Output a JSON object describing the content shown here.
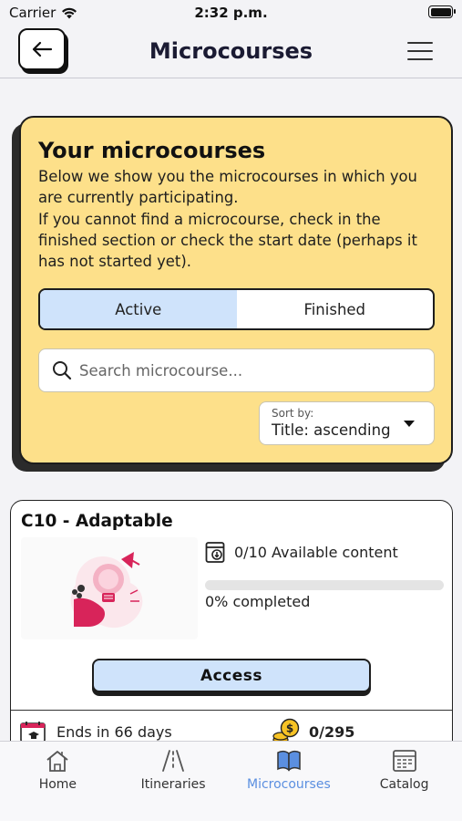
{
  "status_bar": {
    "carrier": "Carrier",
    "time": "2:32 p.m."
  },
  "header": {
    "title": "Microcourses"
  },
  "info": {
    "title": "Your microcourses",
    "lines": [
      "Below we show you the microcourses in which you",
      "are currently participating.",
      "If you cannot find a microcourse, check in the",
      "finished section or check the start date (perhaps it",
      "has not started yet)."
    ],
    "tabs": [
      {
        "label": "Active",
        "selected": true
      },
      {
        "label": "Finished",
        "selected": false
      }
    ],
    "search": {
      "placeholder": "Search microcourse..."
    },
    "sort": {
      "label": "Sort by:",
      "value": "Title: ascending"
    }
  },
  "course": {
    "title": "C10 - Adaptable",
    "available": "0/10 Available content",
    "progress_fraction": 0,
    "completed": "0% completed",
    "access_label": "Access",
    "ends": "Ends in 66 days",
    "coins": "0/295"
  },
  "tabbar": {
    "items": [
      {
        "label": "Home",
        "icon": "home-icon",
        "active": false
      },
      {
        "label": "Itineraries",
        "icon": "road-icon",
        "active": false
      },
      {
        "label": "Microcourses",
        "icon": "book-icon",
        "active": true
      },
      {
        "label": "Catalog",
        "icon": "catalog-icon",
        "active": false
      }
    ]
  },
  "colors": {
    "info_card_bg": "#fde08a",
    "accent_blue": "#cfe3fb",
    "active_tab": "#5b8fe0",
    "image_pink": "#d8245a"
  }
}
